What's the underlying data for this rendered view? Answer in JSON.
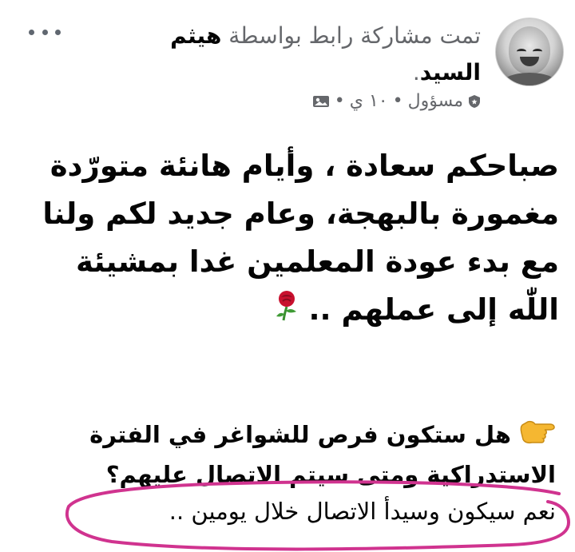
{
  "post": {
    "shared_text": "تمت مشاركة رابط بواسطة",
    "author_name": "هيثم السيد",
    "author_suffix": ".",
    "role": "مسؤول",
    "time": "١٠ ي",
    "separator": "•",
    "main_text": "صباحكم سعادة ، وأيام هانئة متورّدة مغمورة بالبهجة، وعام جديد لكم ولنا مع بدء عودة المعلمين غدا بمشيئة اللّٰه إلى عملهم ..",
    "question": "هل ستكون فرص للشواغر في الفترة الاستدراكية ومتى سيتم الاتصال عليهم؟",
    "answer": "نعم سيكون وسيدأ الاتصال خلال يومين .."
  },
  "icons": {
    "more": "more-options-icon",
    "shield": "admin-shield-icon",
    "photo": "photo-icon",
    "rose": "rose-emoji-icon",
    "hand": "pointing-hand-emoji-icon"
  },
  "colors": {
    "text": "#050505",
    "meta": "#65676b",
    "annotation": "#d0338f",
    "rose": "#c8102e",
    "hand": "#f5b731"
  }
}
